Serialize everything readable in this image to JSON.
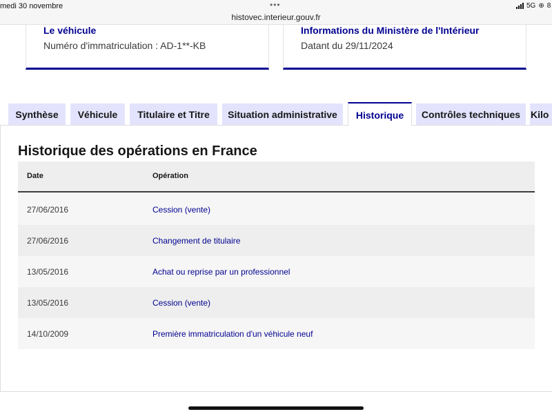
{
  "statusbar": {
    "date": "medi 30 novembre",
    "url": "histovec.interieur.gouv.fr",
    "network": "5G",
    "battery_fragment": "8"
  },
  "cards": [
    {
      "title": "Le véhicule",
      "text": "Numéro d'immatriculation : AD-1**-KB"
    },
    {
      "title": "Informations du Ministère de l'Intérieur",
      "text": "Datant du 29/11/2024"
    }
  ],
  "tabs": [
    {
      "label": "Synthèse",
      "active": false
    },
    {
      "label": "Véhicule",
      "active": false
    },
    {
      "label": "Titulaire et Titre",
      "active": false
    },
    {
      "label": "Situation administrative",
      "active": false
    },
    {
      "label": "Historique",
      "active": true
    },
    {
      "label": "Contrôles techniques",
      "active": false
    },
    {
      "label": "Kilo",
      "active": false
    }
  ],
  "history": {
    "title": "Historique des opérations en France",
    "columns": {
      "date": "Date",
      "operation": "Opération"
    },
    "rows": [
      {
        "date": "27/06/2016",
        "operation": "Cession (vente)"
      },
      {
        "date": "27/06/2016",
        "operation": "Changement de titulaire"
      },
      {
        "date": "13/05/2016",
        "operation": "Achat ou reprise par un professionnel"
      },
      {
        "date": "13/05/2016",
        "operation": "Cession (vente)"
      },
      {
        "date": "14/10/2009",
        "operation": "Première immatriculation d'un véhicule neuf"
      }
    ]
  },
  "colors": {
    "accent": "#000091",
    "tab_bg": "#e3e3fd"
  }
}
